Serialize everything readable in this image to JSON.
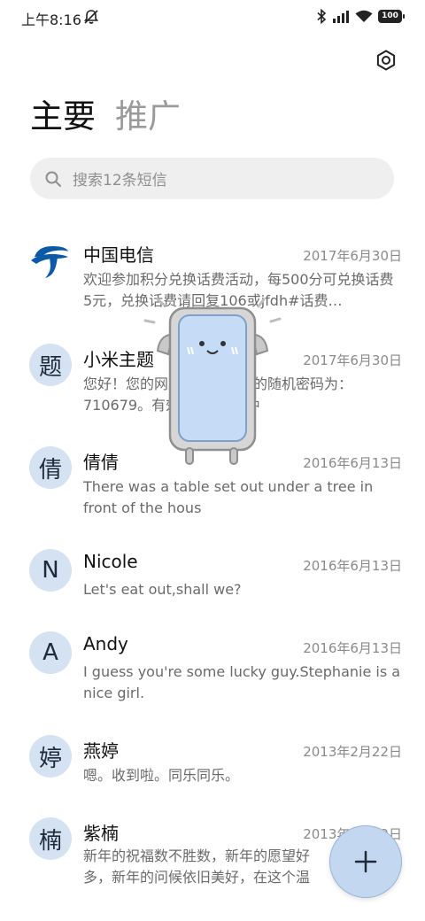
{
  "status_bar": {
    "time": "上午8:16",
    "battery": "100"
  },
  "tabs": [
    {
      "label": "主要",
      "active": true
    },
    {
      "label": "推广",
      "active": false
    }
  ],
  "search": {
    "placeholder": "搜索12条短信"
  },
  "messages": [
    {
      "sender": "中国电信",
      "date": "2017年6月30日",
      "avatar": "",
      "preview": "欢迎参加积分兑换话费活动，每500分可兑换话费5元，兑换话费请回复106或jfdh#话费…"
    },
    {
      "sender": "小米主题",
      "date": "2017年6月30日",
      "avatar": "题",
      "preview": "您好！您的网上营业厅登录的随机密码为：710679。有效时间为3分钟"
    },
    {
      "sender": "倩倩",
      "date": "2016年6月13日",
      "avatar": "倩",
      "preview": "There was a table set out under a tree in front of the hous"
    },
    {
      "sender": "Nicole",
      "date": "2016年6月13日",
      "avatar": "N",
      "preview": "Let's eat out,shall we?"
    },
    {
      "sender": "Andy",
      "date": "2016年6月13日",
      "avatar": "A",
      "preview": "I guess you're some lucky guy.Stephanie is a nice girl."
    },
    {
      "sender": "燕婷",
      "date": "2013年2月22日",
      "avatar": "婷",
      "preview": "嗯。收到啦。同乐同乐。"
    },
    {
      "sender": "紫楠",
      "date": "2013年2月22日",
      "avatar": "楠",
      "preview": "新年的祝福数不胜数，新年的愿望好多，新年的问候依旧美好，在这个温"
    }
  ],
  "colors": {
    "avatar_bg": "#d5e2f2",
    "fab_bg": "#c4d7f0",
    "brand_blue": "#0a5aa8"
  },
  "icons": {
    "settings": "gear-icon",
    "search": "search-icon",
    "compose": "plus-icon",
    "mute": "mute-bell-icon",
    "bluetooth": "bluetooth-icon",
    "signal": "signal-icon",
    "wifi": "wifi-icon",
    "battery": "battery-icon",
    "telecom_logo": "china-telecom-logo"
  }
}
